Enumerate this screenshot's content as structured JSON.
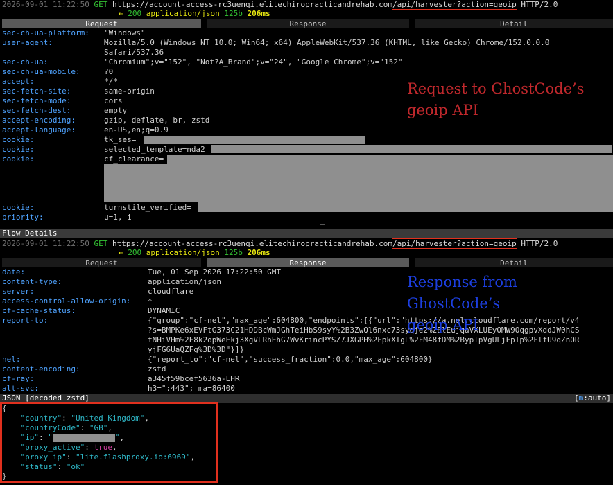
{
  "flow": {
    "timestamp": "2026-09-01 11:22:50",
    "method": "GET",
    "url_base": "https://account-access-rc3uenqi.elitechiropracticandrehab.com",
    "url_path": "/api/harvester?action=geoip",
    "protocol": "HTTP/2.0",
    "status_arrow": "←",
    "status_code": "200",
    "content_type": "application/json",
    "size": "125b",
    "duration": "206ms"
  },
  "tabs": {
    "request": "Request",
    "response": "Response",
    "detail": "Detail"
  },
  "request_headers": [
    {
      "k": "sec-ch-ua-platform:",
      "v": "\"Windows\""
    },
    {
      "k": "user-agent:",
      "v": "Mozilla/5.0 (Windows NT 10.0; Win64; x64) AppleWebKit/537.36 (KHTML, like Gecko) Chrome/152.0.0.0"
    },
    {
      "k": "",
      "v": "Safari/537.36"
    },
    {
      "k": "sec-ch-ua:",
      "v": "\"Chromium\";v=\"152\", \"Not?A_Brand\";v=\"24\", \"Google Chrome\";v=\"152\""
    },
    {
      "k": "sec-ch-ua-mobile:",
      "v": "?0"
    },
    {
      "k": "accept:",
      "v": "*/*"
    },
    {
      "k": "sec-fetch-site:",
      "v": "same-origin"
    },
    {
      "k": "sec-fetch-mode:",
      "v": "cors"
    },
    {
      "k": "sec-fetch-dest:",
      "v": "empty"
    },
    {
      "k": "accept-encoding:",
      "v": "gzip, deflate, br, zstd"
    },
    {
      "k": "accept-language:",
      "v": "en-US,en;q=0.9"
    },
    {
      "k": "cookie:",
      "v": "tk_ses="
    },
    {
      "k": "cookie:",
      "v": "selected_template=nda2"
    },
    {
      "k": "cookie:",
      "v": "cf_clearance="
    },
    {
      "k": "cookie:",
      "v": "turnstile_verified="
    },
    {
      "k": "priority:",
      "v": "u=1, i"
    }
  ],
  "annotation_request": {
    "line1": "Request to GhostCode’s",
    "line2": "geoip API",
    "color": "#c0282c"
  },
  "flow_details_label": "Flow Details",
  "response_headers": [
    {
      "k": "date:",
      "v": "Tue, 01 Sep 2026 17:22:50 GMT"
    },
    {
      "k": "content-type:",
      "v": "application/json"
    },
    {
      "k": "server:",
      "v": "cloudflare"
    },
    {
      "k": "access-control-allow-origin:",
      "v": "*"
    },
    {
      "k": "cf-cache-status:",
      "v": "DYNAMIC"
    },
    {
      "k": "report-to:",
      "v": "{\"group\":\"cf-nel\",\"max_age\":604800,\"endpoints\":[{\"url\":\"https://a.nel.cloudflare.com/report/v4"
    },
    {
      "k": "",
      "v": "?s=BMPKe6xEVFtG373C21HDDBcWmJGhTeiHbS9syY%2B3ZwQl6nxc73syqje2%2BlEujqaVXLUEyOMW9OqgpvXddJW0hCS"
    },
    {
      "k": "",
      "v": "fNHiVHm%2F8k2opWeEkj3XgVLRhEhG7WvKrincPYSZ7JXGPH%2FpkXTgL%2FM48fDM%2BypIpVgULjFpIp%2FlfU9qZnOR"
    },
    {
      "k": "",
      "v": "yjFG6UaQZFg%3D%3D\"}]}"
    },
    {
      "k": "nel:",
      "v": "{\"report_to\":\"cf-nel\",\"success_fraction\":0.0,\"max_age\":604800}"
    },
    {
      "k": "content-encoding:",
      "v": "zstd"
    },
    {
      "k": "cf-ray:",
      "v": "a345f59bcef5636a-LHR"
    },
    {
      "k": "alt-svc:",
      "v": "h3=\":443\"; ma=86400"
    }
  ],
  "annotation_response": {
    "line1": "Response from GhostCode’s",
    "line2": "geoip API",
    "color": "#1c3fe0"
  },
  "json_bar": {
    "label": "JSON [decoded zstd]",
    "mode_open": "[",
    "mode_key": "m",
    "mode_rest": ":auto]"
  },
  "json_body": {
    "open": "{",
    "close": "}",
    "country_key": "\"country\"",
    "country_val": "\"United Kingdom\"",
    "countryCode_key": "\"countryCode\"",
    "countryCode_val": "\"GB\"",
    "ip_key": "\"ip\"",
    "proxy_active_key": "\"proxy_active\"",
    "proxy_active_val": "true",
    "proxy_ip_key": "\"proxy_ip\"",
    "proxy_ip_val": "\"lite.flashproxy.io:6969\"",
    "status_key": "\"status\"",
    "status_val": "\"ok\""
  }
}
